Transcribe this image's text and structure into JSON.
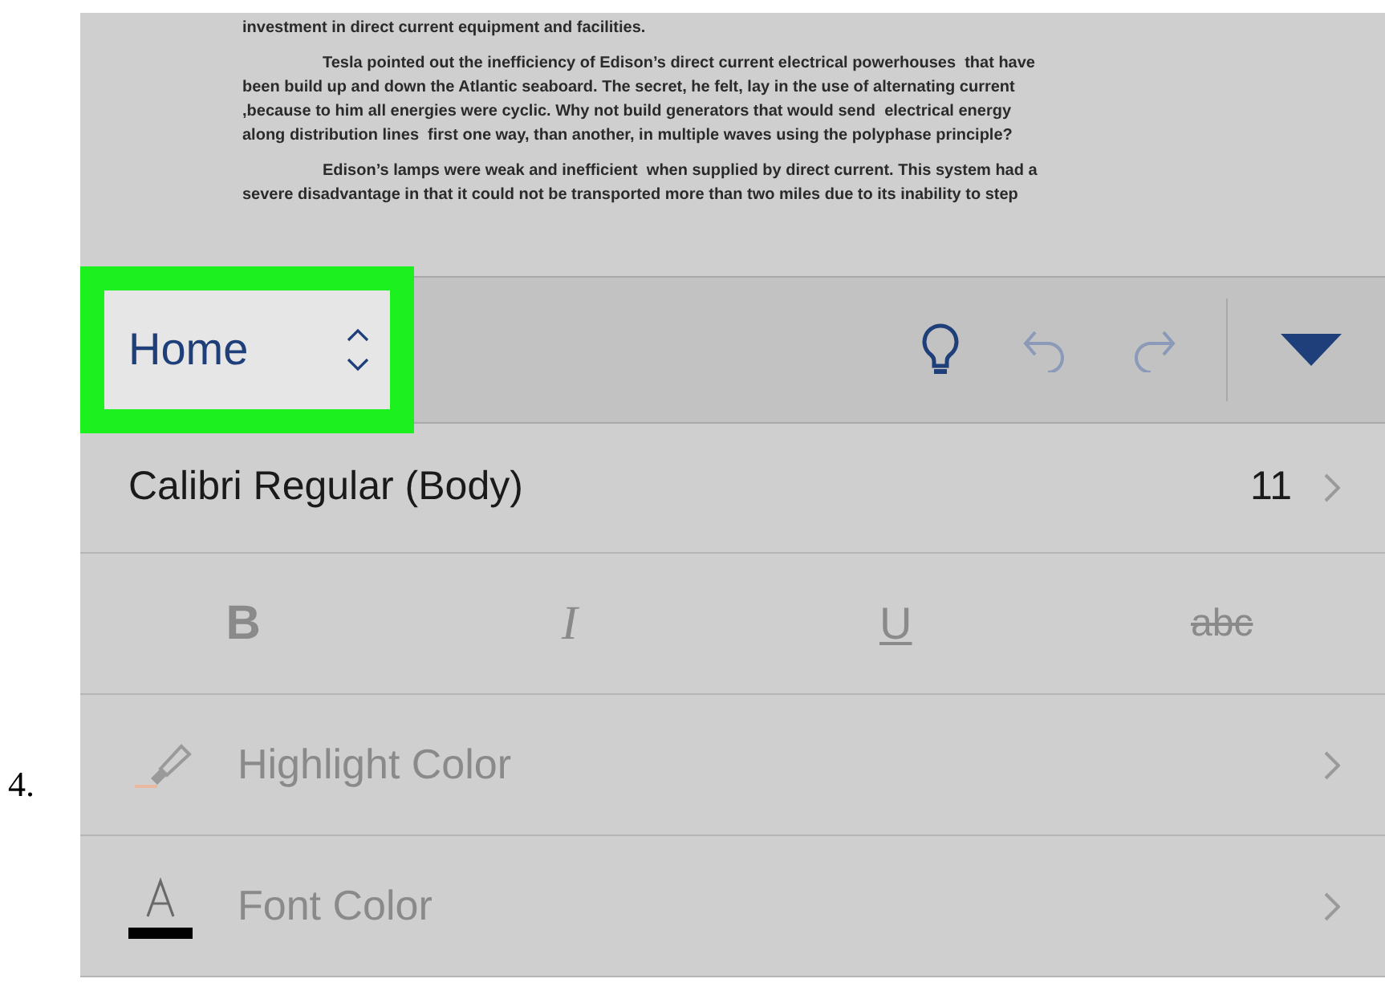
{
  "step_number": "4.",
  "document": {
    "paragraphs": [
      {
        "indent": false,
        "lines": [
          "investment in direct current equipment and facilities."
        ]
      },
      {
        "indent": true,
        "lines": [
          "Tesla pointed out the inefficiency of Edison’s direct current electrical powerhouses  that have",
          "been build up and down the Atlantic seaboard. The secret, he felt, lay in the use of alternating current",
          ",because to him all energies were cyclic. Why not build generators that would send  electrical energy",
          "along distribution lines  first one way, than another, in multiple waves using the polyphase principle?"
        ]
      },
      {
        "indent": true,
        "lines": [
          "Edison’s lamps were weak and inefficient  when supplied by direct current. This system had a",
          "severe disadvantage in that it could not be transported more than two miles due to its inability to step"
        ]
      }
    ]
  },
  "toolbar": {
    "tab_menu": {
      "label": "Home",
      "highlighted": true
    }
  },
  "font_row": {
    "font": "Calibri Regular (Body)",
    "size": "11"
  },
  "format_buttons": [
    {
      "kind": "bold",
      "label": "B"
    },
    {
      "kind": "italic",
      "label": "I"
    },
    {
      "kind": "underline",
      "label": "U"
    },
    {
      "kind": "strike",
      "label": "abc"
    }
  ],
  "color_rows": [
    {
      "kind": "highlight",
      "label": "Highlight Color"
    },
    {
      "kind": "font",
      "label": "Font Color"
    }
  ]
}
